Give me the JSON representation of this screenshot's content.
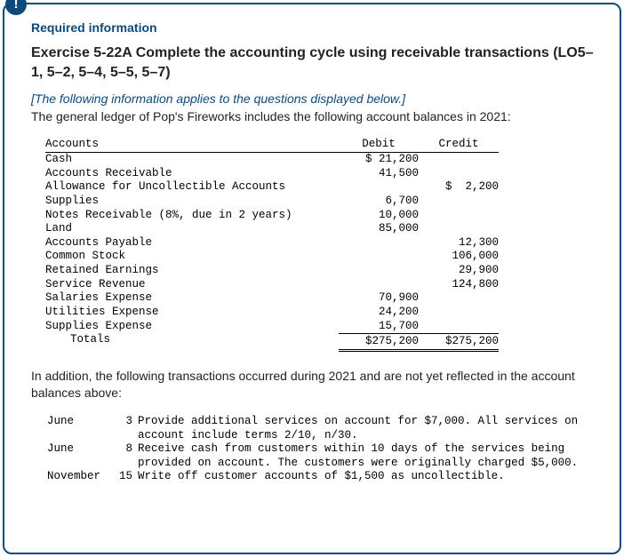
{
  "badge": "!",
  "required_label": "Required information",
  "exercise_title": "Exercise 5-22A Complete the accounting cycle using receivable transactions (LO5–1, 5–2, 5–4, 5–5, 5–7)",
  "italic_note": "[The following information applies to the questions displayed below.]",
  "intro_text": "The general ledger of Pop's Fireworks includes the following account balances in 2021:",
  "ledger": {
    "headers": {
      "accounts": "Accounts",
      "debit": "Debit",
      "credit": "Credit"
    },
    "rows": [
      {
        "acct": "Cash",
        "debit": "$ 21,200",
        "credit": ""
      },
      {
        "acct": "Accounts Receivable",
        "debit": "41,500",
        "credit": ""
      },
      {
        "acct": "Allowance for Uncollectible Accounts",
        "debit": "",
        "credit": "$  2,200"
      },
      {
        "acct": "Supplies",
        "debit": "6,700",
        "credit": ""
      },
      {
        "acct": "Notes Receivable (8%, due in 2 years)",
        "debit": "10,000",
        "credit": ""
      },
      {
        "acct": "Land",
        "debit": "85,000",
        "credit": ""
      },
      {
        "acct": "Accounts Payable",
        "debit": "",
        "credit": "12,300"
      },
      {
        "acct": "Common Stock",
        "debit": "",
        "credit": "106,000"
      },
      {
        "acct": "Retained Earnings",
        "debit": "",
        "credit": "29,900"
      },
      {
        "acct": "Service Revenue",
        "debit": "",
        "credit": "124,800"
      },
      {
        "acct": "Salaries Expense",
        "debit": "70,900",
        "credit": ""
      },
      {
        "acct": "Utilities Expense",
        "debit": "24,200",
        "credit": ""
      },
      {
        "acct": "Supplies Expense",
        "debit": "15,700",
        "credit": ""
      }
    ],
    "totals": {
      "label": "Totals",
      "debit": "$275,200",
      "credit": "$275,200"
    }
  },
  "mid_text": "In addition, the following transactions occurred during 2021 and are not yet reflected in the account balances above:",
  "transactions": [
    {
      "month": "June",
      "day": "3",
      "lines": [
        "Provide additional services on account for $7,000. All services on",
        "account include terms 2/10, n/30."
      ]
    },
    {
      "month": "June",
      "day": "8",
      "lines": [
        "Receive cash from customers within 10 days of the services being",
        "provided on account. The customers were originally charged $5,000."
      ]
    },
    {
      "month": "November",
      "day": "15",
      "lines": [
        "Write off customer accounts of $1,500 as uncollectible."
      ]
    }
  ]
}
